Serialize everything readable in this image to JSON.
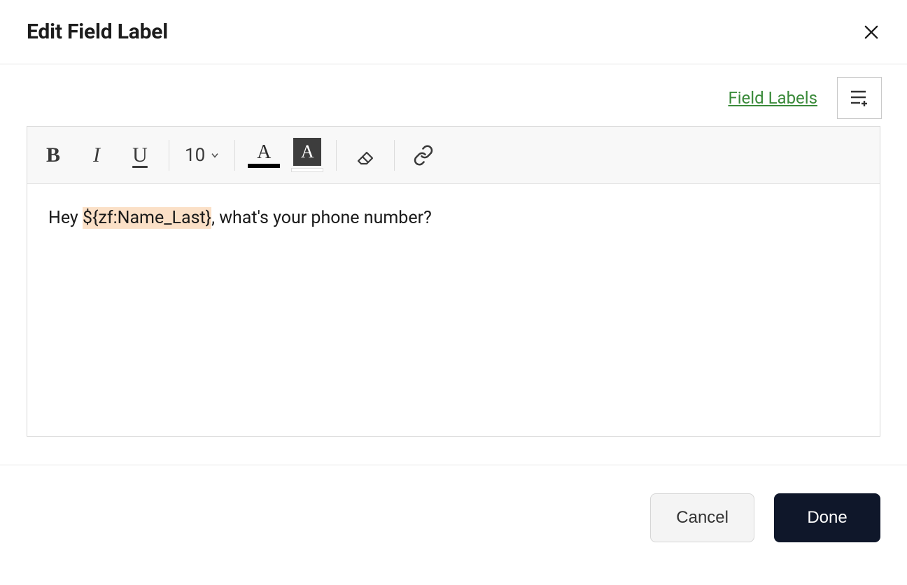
{
  "header": {
    "title": "Edit Field Label"
  },
  "topbar": {
    "field_labels_link": "Field Labels"
  },
  "toolbar": {
    "bold": "B",
    "italic": "I",
    "underline": "U",
    "font_size": "10",
    "text_color_letter": "A",
    "bg_color_letter": "A"
  },
  "editor": {
    "text_before": "Hey ",
    "token": "${zf:Name_Last}",
    "text_after": ", what's your phone number?"
  },
  "footer": {
    "cancel": "Cancel",
    "done": "Done"
  }
}
